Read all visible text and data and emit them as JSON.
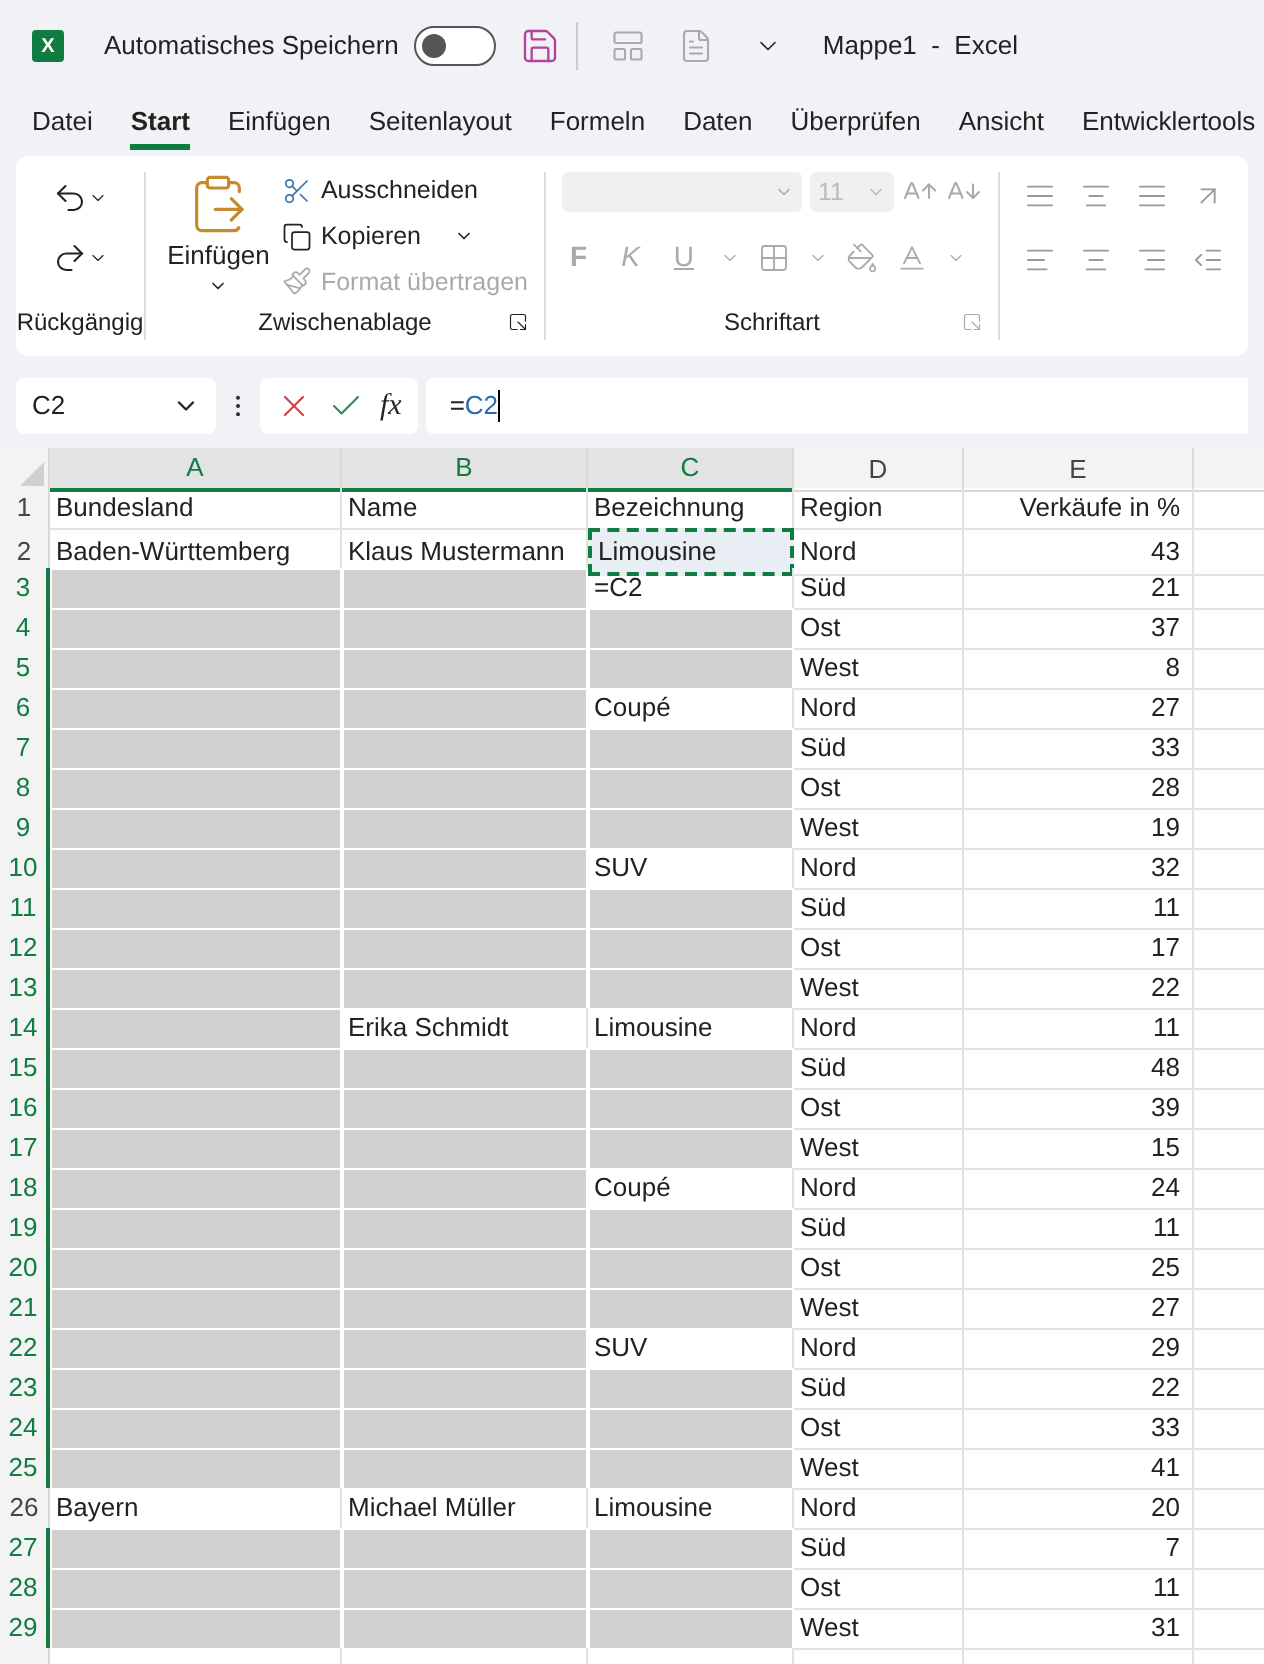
{
  "title_bar": {
    "app_icon": "X",
    "autosave_label": "Automatisches Speichern",
    "autosave_on": false,
    "title": "Mappe1  -  Excel"
  },
  "tabs": [
    {
      "label": "Datei",
      "selected": false
    },
    {
      "label": "Start",
      "selected": true
    },
    {
      "label": "Einfügen",
      "selected": false
    },
    {
      "label": "Seitenlayout",
      "selected": false
    },
    {
      "label": "Formeln",
      "selected": false
    },
    {
      "label": "Daten",
      "selected": false
    },
    {
      "label": "Überprüfen",
      "selected": false
    },
    {
      "label": "Ansicht",
      "selected": false
    },
    {
      "label": "Entwicklertools",
      "selected": false
    }
  ],
  "ribbon": {
    "undo_group": "Rückgängig",
    "clipboard": {
      "title": "Zwischenablage",
      "paste": "Einfügen",
      "cut": "Ausschneiden",
      "copy": "Kopieren",
      "format_painter": "Format übertragen",
      "format_painter_disabled": true
    },
    "font": {
      "title": "Schriftart",
      "size": "11",
      "bold": "F",
      "italic": "K",
      "underline": "U"
    }
  },
  "formula_bar": {
    "name_box": "C2",
    "fx": "fx",
    "formula_prefix": "=",
    "formula_ref": "C2"
  },
  "columns": [
    {
      "label": "A",
      "selected": true
    },
    {
      "label": "B",
      "selected": true
    },
    {
      "label": "C",
      "selected": true
    },
    {
      "label": "D",
      "selected": false
    },
    {
      "label": "E",
      "selected": false
    }
  ],
  "rows": [
    {
      "number": "1",
      "selected": false,
      "cells": [
        {
          "text": "Bundesland",
          "selected": false
        },
        {
          "text": "Name",
          "selected": false
        },
        {
          "text": "Bezeichnung",
          "selected": false
        },
        {
          "text": "Region",
          "selected": false
        },
        {
          "text": "Verkäufe in %",
          "selected": false
        }
      ]
    },
    {
      "number": "2",
      "selected": false,
      "cells": [
        {
          "text": "Baden-Württemberg",
          "selected": false
        },
        {
          "text": "Klaus Mustermann",
          "selected": false
        },
        {
          "text": "Limousine",
          "selected": false,
          "copied": true
        },
        {
          "text": "Nord",
          "selected": false
        },
        {
          "text": "43",
          "selected": false
        }
      ]
    },
    {
      "number": "3",
      "selected": true,
      "cells": [
        {
          "selected": true
        },
        {
          "selected": true
        },
        {
          "text": "=C2",
          "selected": false
        },
        {
          "text": "Süd",
          "selected": false
        },
        {
          "text": "21",
          "selected": false
        }
      ]
    },
    {
      "number": "4",
      "selected": true,
      "cells": [
        {
          "selected": true
        },
        {
          "selected": true
        },
        {
          "selected": true
        },
        {
          "text": "Ost",
          "selected": false
        },
        {
          "text": "37",
          "selected": false
        }
      ]
    },
    {
      "number": "5",
      "selected": true,
      "cells": [
        {
          "selected": true
        },
        {
          "selected": true
        },
        {
          "selected": true
        },
        {
          "text": "West",
          "selected": false
        },
        {
          "text": "8",
          "selected": false
        }
      ]
    },
    {
      "number": "6",
      "selected": true,
      "cells": [
        {
          "selected": true
        },
        {
          "selected": true
        },
        {
          "text": "Coupé",
          "selected": false
        },
        {
          "text": "Nord",
          "selected": false
        },
        {
          "text": "27",
          "selected": false
        }
      ]
    },
    {
      "number": "7",
      "selected": true,
      "cells": [
        {
          "selected": true
        },
        {
          "selected": true
        },
        {
          "selected": true
        },
        {
          "text": "Süd",
          "selected": false
        },
        {
          "text": "33",
          "selected": false
        }
      ]
    },
    {
      "number": "8",
      "selected": true,
      "cells": [
        {
          "selected": true
        },
        {
          "selected": true
        },
        {
          "selected": true
        },
        {
          "text": "Ost",
          "selected": false
        },
        {
          "text": "28",
          "selected": false
        }
      ]
    },
    {
      "number": "9",
      "selected": true,
      "cells": [
        {
          "selected": true
        },
        {
          "selected": true
        },
        {
          "selected": true
        },
        {
          "text": "West",
          "selected": false
        },
        {
          "text": "19",
          "selected": false
        }
      ]
    },
    {
      "number": "10",
      "selected": true,
      "cells": [
        {
          "selected": true
        },
        {
          "selected": true
        },
        {
          "text": "SUV",
          "selected": false
        },
        {
          "text": "Nord",
          "selected": false
        },
        {
          "text": "32",
          "selected": false
        }
      ]
    },
    {
      "number": "11",
      "selected": true,
      "cells": [
        {
          "selected": true
        },
        {
          "selected": true
        },
        {
          "selected": true
        },
        {
          "text": "Süd",
          "selected": false
        },
        {
          "text": "11",
          "selected": false
        }
      ]
    },
    {
      "number": "12",
      "selected": true,
      "cells": [
        {
          "selected": true
        },
        {
          "selected": true
        },
        {
          "selected": true
        },
        {
          "text": "Ost",
          "selected": false
        },
        {
          "text": "17",
          "selected": false
        }
      ]
    },
    {
      "number": "13",
      "selected": true,
      "cells": [
        {
          "selected": true
        },
        {
          "selected": true
        },
        {
          "selected": true
        },
        {
          "text": "West",
          "selected": false
        },
        {
          "text": "22",
          "selected": false
        }
      ]
    },
    {
      "number": "14",
      "selected": true,
      "cells": [
        {
          "selected": true
        },
        {
          "text": "Erika Schmidt",
          "selected": false
        },
        {
          "text": "Limousine",
          "selected": false
        },
        {
          "text": "Nord",
          "selected": false
        },
        {
          "text": "11",
          "selected": false
        }
      ]
    },
    {
      "number": "15",
      "selected": true,
      "cells": [
        {
          "selected": true
        },
        {
          "selected": true
        },
        {
          "selected": true
        },
        {
          "text": "Süd",
          "selected": false
        },
        {
          "text": "48",
          "selected": false
        }
      ]
    },
    {
      "number": "16",
      "selected": true,
      "cells": [
        {
          "selected": true
        },
        {
          "selected": true
        },
        {
          "selected": true
        },
        {
          "text": "Ost",
          "selected": false
        },
        {
          "text": "39",
          "selected": false
        }
      ]
    },
    {
      "number": "17",
      "selected": true,
      "cells": [
        {
          "selected": true
        },
        {
          "selected": true
        },
        {
          "selected": true
        },
        {
          "text": "West",
          "selected": false
        },
        {
          "text": "15",
          "selected": false
        }
      ]
    },
    {
      "number": "18",
      "selected": true,
      "cells": [
        {
          "selected": true
        },
        {
          "selected": true
        },
        {
          "text": "Coupé",
          "selected": false
        },
        {
          "text": "Nord",
          "selected": false
        },
        {
          "text": "24",
          "selected": false
        }
      ]
    },
    {
      "number": "19",
      "selected": true,
      "cells": [
        {
          "selected": true
        },
        {
          "selected": true
        },
        {
          "selected": true
        },
        {
          "text": "Süd",
          "selected": false
        },
        {
          "text": "11",
          "selected": false
        }
      ]
    },
    {
      "number": "20",
      "selected": true,
      "cells": [
        {
          "selected": true
        },
        {
          "selected": true
        },
        {
          "selected": true
        },
        {
          "text": "Ost",
          "selected": false
        },
        {
          "text": "25",
          "selected": false
        }
      ]
    },
    {
      "number": "21",
      "selected": true,
      "cells": [
        {
          "selected": true
        },
        {
          "selected": true
        },
        {
          "selected": true
        },
        {
          "text": "West",
          "selected": false
        },
        {
          "text": "27",
          "selected": false
        }
      ]
    },
    {
      "number": "22",
      "selected": true,
      "cells": [
        {
          "selected": true
        },
        {
          "selected": true
        },
        {
          "text": "SUV",
          "selected": false
        },
        {
          "text": "Nord",
          "selected": false
        },
        {
          "text": "29",
          "selected": false
        }
      ]
    },
    {
      "number": "23",
      "selected": true,
      "cells": [
        {
          "selected": true
        },
        {
          "selected": true
        },
        {
          "selected": true
        },
        {
          "text": "Süd",
          "selected": false
        },
        {
          "text": "22",
          "selected": false
        }
      ]
    },
    {
      "number": "24",
      "selected": true,
      "cells": [
        {
          "selected": true
        },
        {
          "selected": true
        },
        {
          "selected": true
        },
        {
          "text": "Ost",
          "selected": false
        },
        {
          "text": "33",
          "selected": false
        }
      ]
    },
    {
      "number": "25",
      "selected": true,
      "cells": [
        {
          "selected": true
        },
        {
          "selected": true
        },
        {
          "selected": true
        },
        {
          "text": "West",
          "selected": false
        },
        {
          "text": "41",
          "selected": false
        }
      ]
    },
    {
      "number": "26",
      "selected": false,
      "cells": [
        {
          "text": "Bayern",
          "selected": false
        },
        {
          "text": "Michael Müller",
          "selected": false
        },
        {
          "text": "Limousine",
          "selected": false
        },
        {
          "text": "Nord",
          "selected": false
        },
        {
          "text": "20",
          "selected": false
        }
      ]
    },
    {
      "number": "27",
      "selected": true,
      "cells": [
        {
          "selected": true
        },
        {
          "selected": true
        },
        {
          "selected": true
        },
        {
          "text": "Süd",
          "selected": false
        },
        {
          "text": "7",
          "selected": false
        }
      ]
    },
    {
      "number": "28",
      "selected": true,
      "cells": [
        {
          "selected": true
        },
        {
          "selected": true
        },
        {
          "selected": true
        },
        {
          "text": "Ost",
          "selected": false
        },
        {
          "text": "11",
          "selected": false
        }
      ]
    },
    {
      "number": "29",
      "selected": true,
      "cells": [
        {
          "selected": true
        },
        {
          "selected": true
        },
        {
          "selected": true
        },
        {
          "text": "West",
          "selected": false
        },
        {
          "text": "31",
          "selected": false
        }
      ]
    }
  ]
}
